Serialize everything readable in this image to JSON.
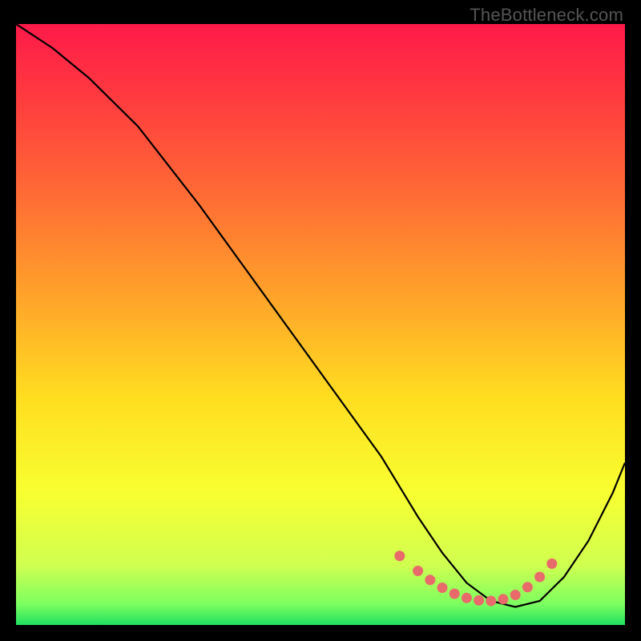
{
  "watermark": "TheBottleneck.com",
  "chart_data": {
    "type": "line",
    "title": "",
    "xlabel": "",
    "ylabel": "",
    "xlim": [
      0,
      100
    ],
    "ylim": [
      0,
      100
    ],
    "background_gradient": {
      "direction": "vertical",
      "stops": [
        {
          "pos": 0.0,
          "color": "#ff1a4a"
        },
        {
          "pos": 0.12,
          "color": "#ff3a3f"
        },
        {
          "pos": 0.28,
          "color": "#ff6a35"
        },
        {
          "pos": 0.45,
          "color": "#ffa22a"
        },
        {
          "pos": 0.62,
          "color": "#ffdd20"
        },
        {
          "pos": 0.78,
          "color": "#f8ff30"
        },
        {
          "pos": 0.9,
          "color": "#d0ff50"
        },
        {
          "pos": 0.965,
          "color": "#7dff60"
        },
        {
          "pos": 1.0,
          "color": "#20e060"
        }
      ]
    },
    "series": [
      {
        "name": "curve",
        "color": "#000000",
        "x": [
          0,
          6,
          12,
          20,
          30,
          40,
          50,
          60,
          66,
          70,
          74,
          78,
          82,
          86,
          90,
          94,
          98,
          100
        ],
        "y": [
          100,
          96,
          91,
          83,
          70,
          56,
          42,
          28,
          18,
          12,
          7,
          4,
          3,
          4,
          8,
          14,
          22,
          27
        ]
      }
    ],
    "scatter": {
      "name": "optimum-points",
      "color": "#e86a6a",
      "points": [
        {
          "x": 63,
          "y": 11.5
        },
        {
          "x": 66,
          "y": 9.0
        },
        {
          "x": 68,
          "y": 7.5
        },
        {
          "x": 70,
          "y": 6.2
        },
        {
          "x": 72,
          "y": 5.2
        },
        {
          "x": 74,
          "y": 4.5
        },
        {
          "x": 76,
          "y": 4.1
        },
        {
          "x": 78,
          "y": 4.0
        },
        {
          "x": 80,
          "y": 4.3
        },
        {
          "x": 82,
          "y": 5.0
        },
        {
          "x": 84,
          "y": 6.3
        },
        {
          "x": 86,
          "y": 8.0
        },
        {
          "x": 88,
          "y": 10.2
        }
      ]
    }
  }
}
